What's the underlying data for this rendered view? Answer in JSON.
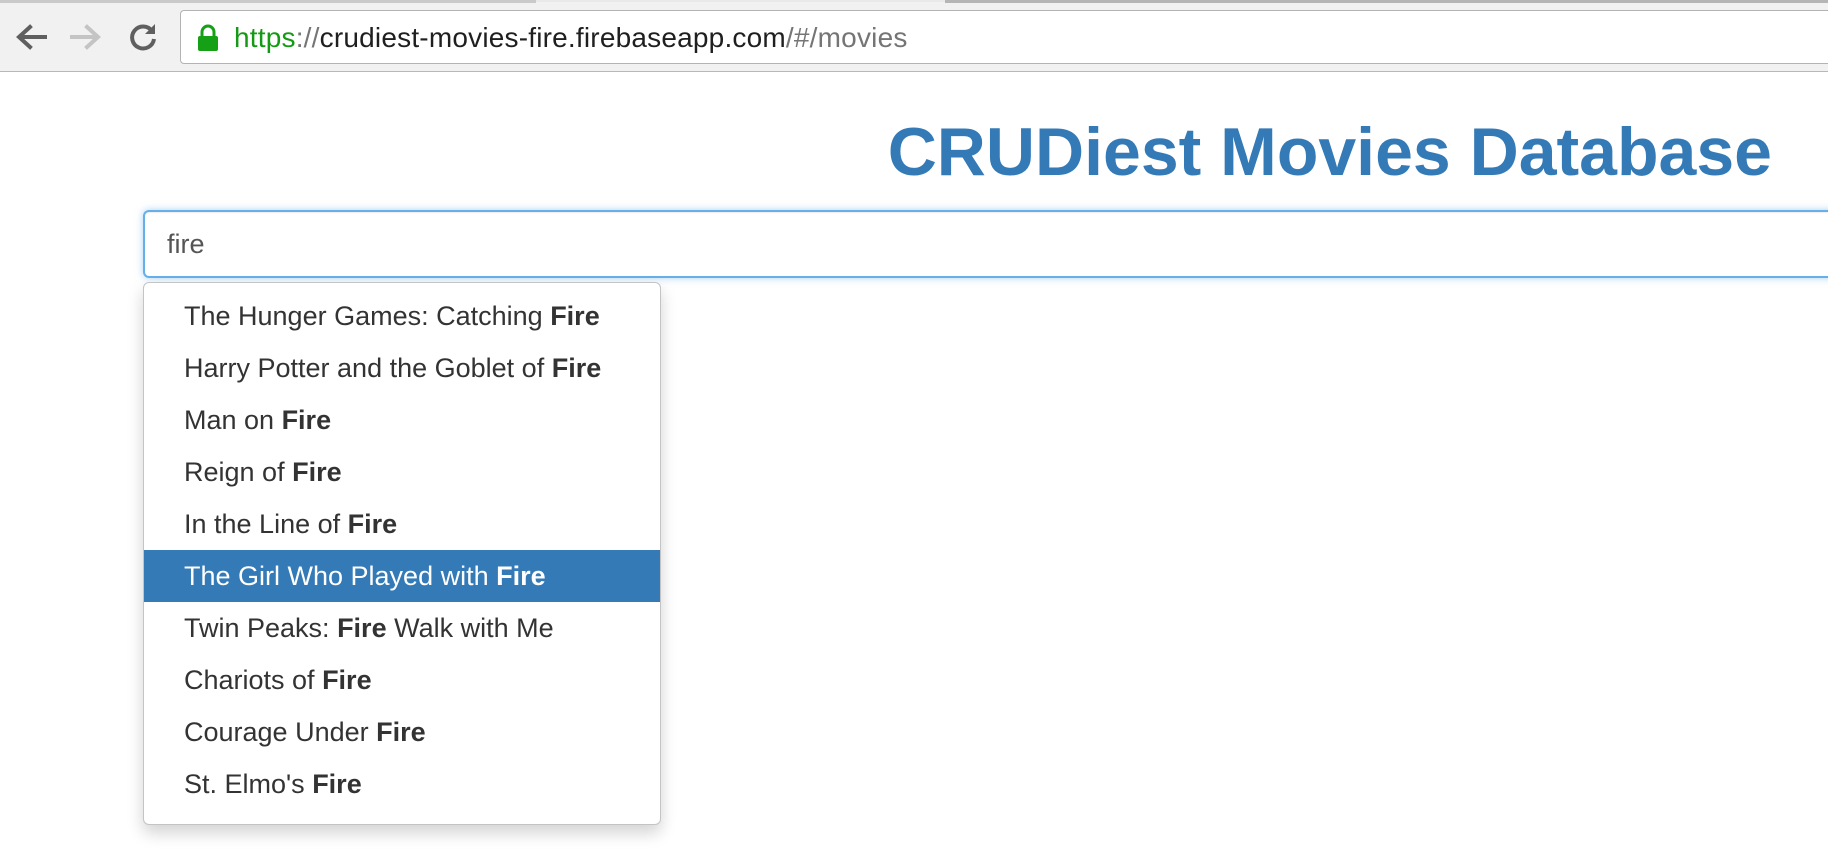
{
  "browser": {
    "url": {
      "scheme": "https",
      "separator": "://",
      "host": "crudiest-movies-fire.firebaseapp.com",
      "path": "/#/movies"
    },
    "icons": {
      "back": "arrow-left-icon",
      "forward": "arrow-right-icon",
      "reload": "reload-icon",
      "secure": "lock-icon"
    },
    "colors": {
      "secure_green": "#149a14"
    }
  },
  "page": {
    "title": "CRUDiest Movies Database",
    "title_color": "#337ab7",
    "search": {
      "value": "fire",
      "focus_color": "#66afe9"
    },
    "suggestions": [
      {
        "before": "The Hunger Games: Catching ",
        "match": "Fire",
        "after": "",
        "active": false
      },
      {
        "before": "Harry Potter and the Goblet of ",
        "match": "Fire",
        "after": "",
        "active": false
      },
      {
        "before": "Man on ",
        "match": "Fire",
        "after": "",
        "active": false
      },
      {
        "before": "Reign of ",
        "match": "Fire",
        "after": "",
        "active": false
      },
      {
        "before": "In the Line of ",
        "match": "Fire",
        "after": "",
        "active": false
      },
      {
        "before": "The Girl Who Played with ",
        "match": "Fire",
        "after": "",
        "active": true
      },
      {
        "before": "Twin Peaks: ",
        "match": "Fire",
        "after": " Walk with Me",
        "active": false
      },
      {
        "before": "Chariots of ",
        "match": "Fire",
        "after": "",
        "active": false
      },
      {
        "before": "Courage Under ",
        "match": "Fire",
        "after": "",
        "active": false
      },
      {
        "before": "St. Elmo's ",
        "match": "Fire",
        "after": "",
        "active": false
      }
    ],
    "active_color": "#337ab7"
  }
}
